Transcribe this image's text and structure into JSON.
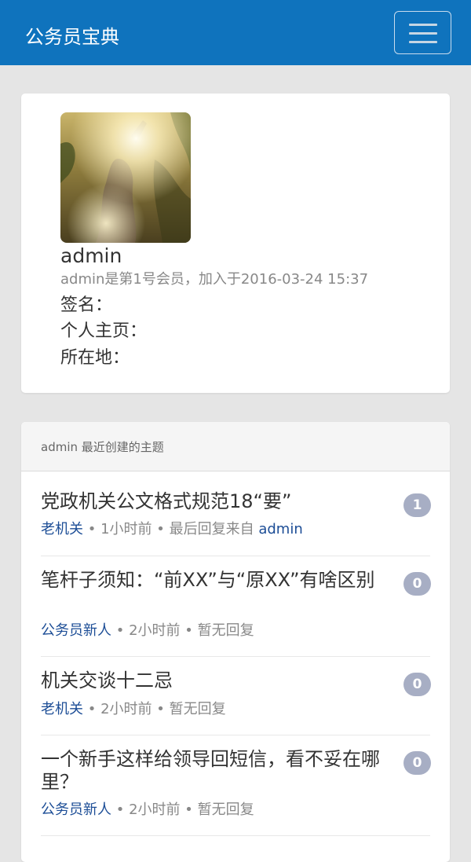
{
  "navbar": {
    "brand": "公务员宝典",
    "menu_icon": "hamburger-icon"
  },
  "profile": {
    "username": "admin",
    "meta": "admin是第1号会员，加入于2016-03-24 15:37",
    "signature_label": "签名：",
    "homepage_label": "个人主页：",
    "location_label": "所在地："
  },
  "topics": {
    "header": "admin 最近创建的主题",
    "items": [
      {
        "title": "党政机关公文格式规范18“要”",
        "node": "老机关",
        "time": "1小时前",
        "reply_text": "最后回复来自",
        "reply_by": "admin",
        "count": "1"
      },
      {
        "title": "笔杆子须知：“前XX”与“原XX”有啥区别",
        "node": "公务员新人",
        "time": "2小时前",
        "reply_text": "暂无回复",
        "reply_by": "",
        "count": "0"
      },
      {
        "title": "机关交谈十二忌",
        "node": "老机关",
        "time": "2小时前",
        "reply_text": "暂无回复",
        "reply_by": "",
        "count": "0"
      },
      {
        "title": "一个新手这样给领导回短信，看不妥在哪里？",
        "node": "公务员新人",
        "time": "2小时前",
        "reply_text": "暂无回复",
        "reply_by": "",
        "count": "0"
      }
    ]
  },
  "colors": {
    "navbar": "#0f73bd",
    "link": "#1c4d96",
    "badge": "#a7aec4",
    "background": "#e5e5e5"
  }
}
